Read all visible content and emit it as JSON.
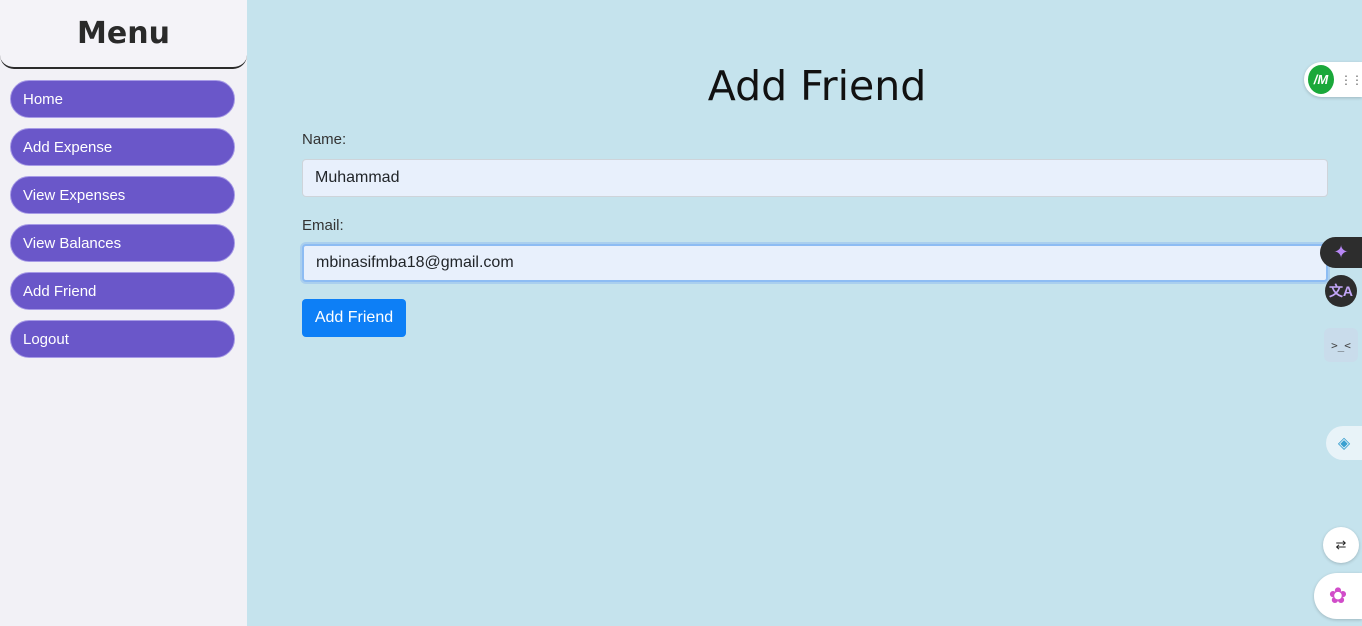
{
  "sidebar": {
    "title": "Menu",
    "items": [
      {
        "label": "Home"
      },
      {
        "label": "Add Expense"
      },
      {
        "label": "View Expenses"
      },
      {
        "label": "View Balances"
      },
      {
        "label": "Add Friend"
      },
      {
        "label": "Logout"
      }
    ]
  },
  "main": {
    "title": "Add Friend",
    "name_label": "Name:",
    "name_value": "Muhammad",
    "email_label": "Email:",
    "email_value": "mbinasifmba18@gmail.com",
    "submit_label": "Add Friend"
  },
  "extensions": {
    "m_badge": "/M",
    "sparkle_icon": "✦",
    "translate_icon": "文A",
    "code_icon": ">_<",
    "layers_icon": "◈",
    "lang_icon": "⇄",
    "brain_icon": "✿"
  },
  "colors": {
    "page_bg": "#c5e3ed",
    "menu_item": "#6a57c9",
    "primary_button": "#0d7ff6"
  }
}
